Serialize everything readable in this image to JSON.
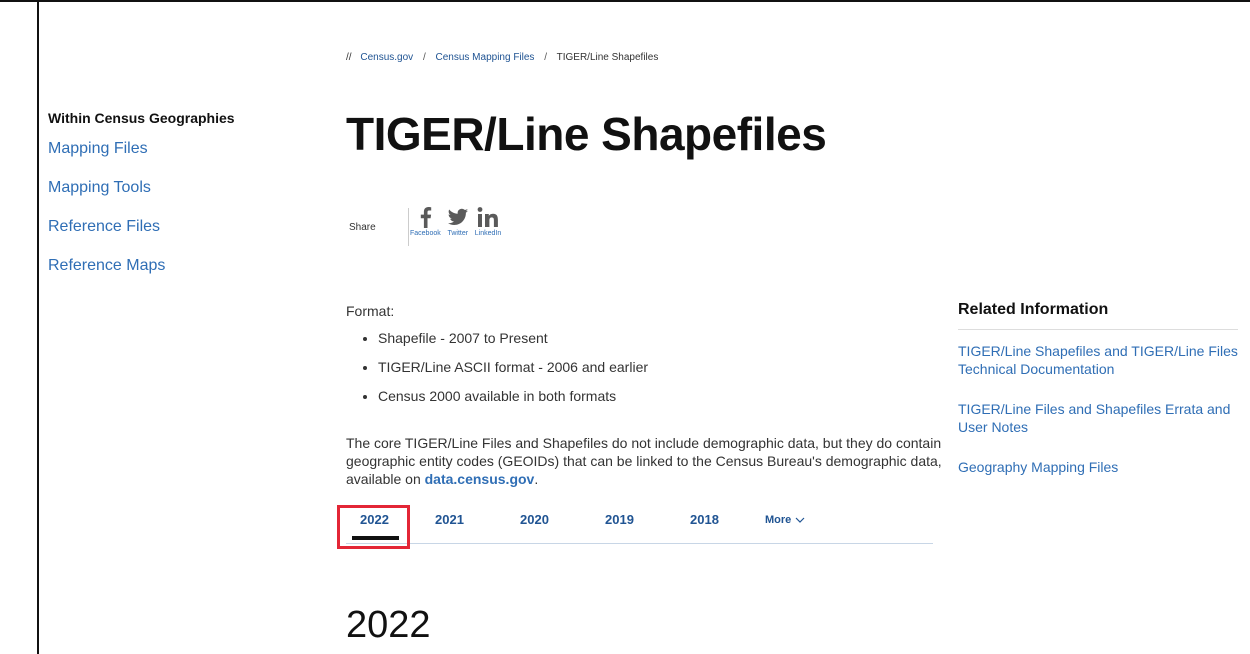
{
  "breadcrumb": {
    "prefix": "//",
    "items": [
      {
        "label": "Census.gov"
      },
      {
        "label": "Census Mapping Files"
      },
      {
        "label": "TIGER/Line Shapefiles"
      }
    ],
    "separator": "/"
  },
  "sidebar": {
    "heading": "Within Census Geographies",
    "items": [
      {
        "label": "Mapping Files"
      },
      {
        "label": "Mapping Tools"
      },
      {
        "label": "Reference Files"
      },
      {
        "label": "Reference Maps"
      }
    ]
  },
  "page": {
    "title": "TIGER/Line Shapefiles"
  },
  "share": {
    "label": "Share",
    "items": [
      {
        "label": "Facebook",
        "icon": "facebook-icon"
      },
      {
        "label": "Twitter",
        "icon": "twitter-icon"
      },
      {
        "label": "LinkedIn",
        "icon": "linkedin-icon"
      }
    ]
  },
  "format": {
    "label": "Format:",
    "items": [
      "Shapefile - 2007 to Present",
      "TIGER/Line ASCII format - 2006 and earlier",
      "Census 2000 available in both formats"
    ],
    "description": "The core TIGER/Line Files and Shapefiles do not include demographic data, but they do contain geographic entity codes (GEOIDs) that can be linked to the Census Bureau's demographic data, available on ",
    "link": "data.census.gov",
    "suffix": "."
  },
  "tabs": {
    "items": [
      "2022",
      "2021",
      "2020",
      "2019",
      "2018"
    ],
    "more": "More",
    "active": "2022"
  },
  "section": {
    "heading": "2022"
  },
  "related": {
    "heading": "Related Information",
    "items": [
      "TIGER/Line Shapefiles and TIGER/Line Files Technical Documentation",
      "TIGER/Line Files and Shapefiles Errata and User Notes",
      "Geography Mapping Files"
    ]
  },
  "colors": {
    "link": "#2f6eb5",
    "tab": "#205493",
    "highlight": "#e32636",
    "share_icon": "#5a5a5a"
  }
}
